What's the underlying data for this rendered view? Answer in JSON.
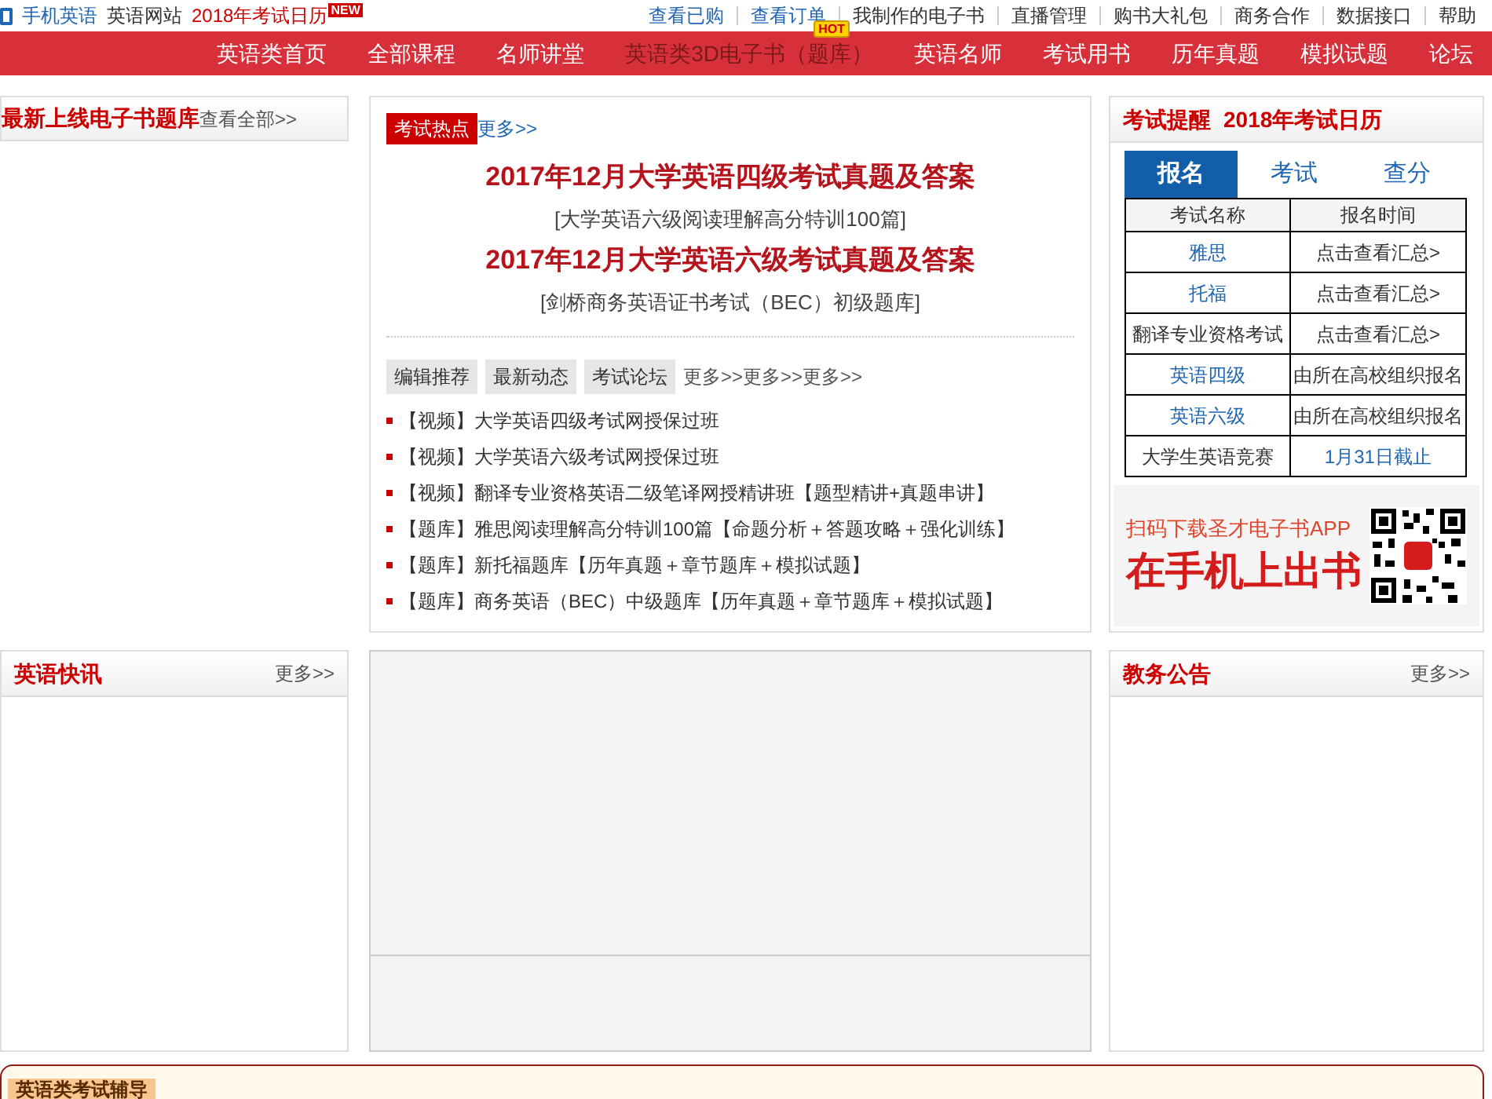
{
  "top_bar": {
    "left_links": [
      {
        "text": "手机英语",
        "kind": "phone"
      },
      {
        "text": "英语网站",
        "kind": "plain"
      },
      {
        "text": "2018年考试日历",
        "kind": "calendar"
      }
    ],
    "new_badge": "NEW",
    "right_links": [
      "查看已购",
      "查看订单",
      "我制作的电子书",
      "直播管理",
      "购书大礼包",
      "商务合作",
      "数据接口",
      "帮助"
    ]
  },
  "nav": {
    "items": [
      {
        "label": "英语类首页",
        "selected": false
      },
      {
        "label": "全部课程",
        "selected": false
      },
      {
        "label": "名师讲堂",
        "selected": false
      },
      {
        "label": "英语类3D电子书（题库）",
        "selected": true,
        "badge": "HOT"
      },
      {
        "label": "英语名师",
        "selected": false
      },
      {
        "label": "考试用书",
        "selected": false
      },
      {
        "label": "历年真题",
        "selected": false
      },
      {
        "label": "模拟试题",
        "selected": false
      },
      {
        "label": "论坛",
        "selected": false
      }
    ]
  },
  "ebook_panel": {
    "title": "最新上线电子书题库",
    "more": "查看全部>>"
  },
  "hot_panel": {
    "label": "考试热点",
    "more": "更多>>",
    "headlines": [
      {
        "text": "2017年12月大学英语四级考试真题及答案",
        "kind": "headline"
      },
      {
        "text": "[大学英语六级阅读理解高分特训100篇]",
        "kind": "sub"
      },
      {
        "text": "2017年12月大学英语六级考试真题及答案",
        "kind": "headline"
      },
      {
        "text": "[剑桥商务英语证书考试（BEC）初级题库]",
        "kind": "sub"
      }
    ],
    "tabs": [
      "编辑推荐",
      "最新动态",
      "考试论坛"
    ],
    "more_links": [
      "更多>>",
      "更多>>",
      "更多>>"
    ],
    "items": [
      "【视频】大学英语四级考试网授保过班",
      "【视频】大学英语六级考试网授保过班",
      "【视频】翻译专业资格英语二级笔译网授精讲班【题型精讲+真题串讲】",
      "【题库】雅思阅读理解高分特训100篇【命题分析＋答题攻略＋强化训练】",
      "【题库】新托福题库【历年真题＋章节题库＋模拟试题】",
      "【题库】商务英语（BEC）中级题库【历年真题＋章节题库＋模拟试题】"
    ]
  },
  "exam_panel": {
    "title": "考试提醒",
    "subtitle": "2018年考试日历",
    "tabs": [
      {
        "label": "报名",
        "selected": true
      },
      {
        "label": "考试",
        "selected": false
      },
      {
        "label": "查分",
        "selected": false
      }
    ],
    "columns": [
      "考试名称",
      "报名时间"
    ],
    "rows": [
      {
        "cells": [
          {
            "text": "雅思",
            "link": true
          },
          {
            "text": "点击查看汇总>",
            "link": false
          }
        ]
      },
      {
        "cells": [
          {
            "text": "托福",
            "link": true
          },
          {
            "text": "点击查看汇总>",
            "link": false
          }
        ]
      },
      {
        "cells": [
          {
            "text": "翻译专业资格考试",
            "link": false
          },
          {
            "text": "点击查看汇总>",
            "link": false
          }
        ]
      },
      {
        "cells": [
          {
            "text": "英语四级",
            "link": true
          },
          {
            "text": "由所在高校组织报名",
            "link": false
          }
        ]
      },
      {
        "cells": [
          {
            "text": "英语六级",
            "link": true
          },
          {
            "text": "由所在高校组织报名",
            "link": false
          }
        ]
      },
      {
        "cells": [
          {
            "text": "大学生英语竞赛",
            "link": false
          },
          {
            "text": "1月31日截止",
            "link": true
          }
        ]
      }
    ],
    "promo": {
      "line1": "扫码下载圣才电子书APP",
      "line2": "在手机上出书"
    }
  },
  "news_panel": {
    "title": "英语快讯",
    "more": "更多>>"
  },
  "notice_panel": {
    "title": "教务公告",
    "more": "更多>>"
  },
  "bottom_section": {
    "tab": "英语类考试辅导"
  }
}
